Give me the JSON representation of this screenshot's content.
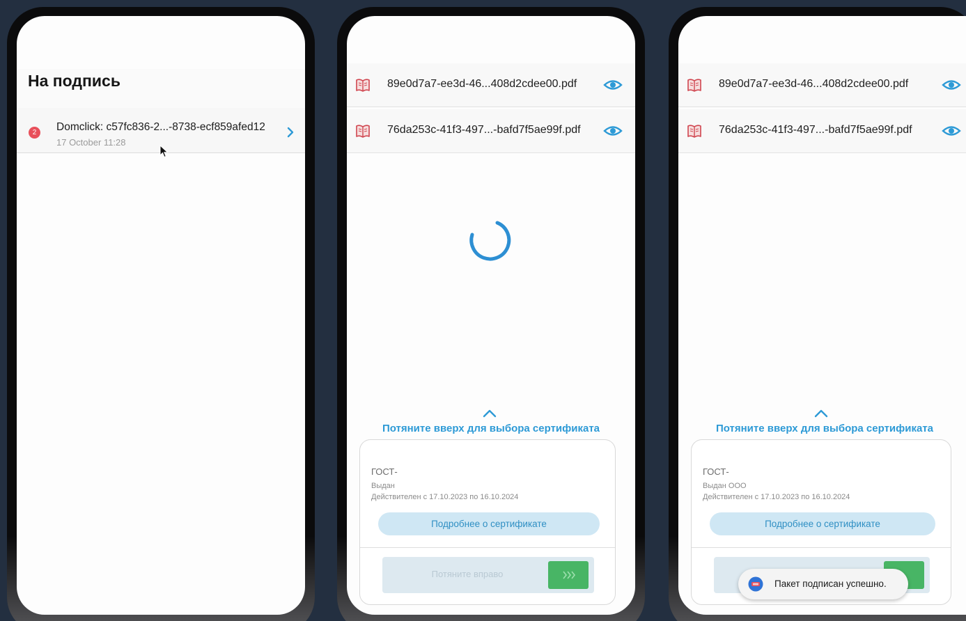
{
  "colors": {
    "accent": "#2d9ad6",
    "badge": "#e8505b",
    "swipe_knob": "#48b565",
    "background": "#232f40"
  },
  "screen1": {
    "title": "На подпись",
    "item": {
      "badge_count": "2",
      "title": "Domclick: c57fc836-2...-8738-ecf859afed12",
      "date": "17 October 11:28",
      "chevron_icon": "chevron-right-icon"
    }
  },
  "screen2": {
    "files": [
      {
        "name": "89e0d7a7-ee3d-46...408d2cdee00.pdf",
        "icon": "book-icon",
        "preview_icon": "eye-icon"
      },
      {
        "name": "76da253c-41f3-497...-bafd7f5ae99f.pdf",
        "icon": "book-icon",
        "preview_icon": "eye-icon"
      }
    ],
    "loading_icon": "spinner-icon",
    "pull_up_label": "Потяните вверх для выбора сертификата",
    "cert": {
      "name": "ГОСТ-",
      "issuer": "Выдан",
      "validity": "Действителен с 17.10.2023 по 16.10.2024",
      "details_button": "Подробнее о сертификате",
      "swipe_label": "Потяните вправо"
    }
  },
  "screen3": {
    "files": [
      {
        "name": "89e0d7a7-ee3d-46...408d2cdee00.pdf",
        "icon": "book-icon",
        "preview_icon": "eye-icon"
      },
      {
        "name": "76da253c-41f3-497...-bafd7f5ae99f.pdf",
        "icon": "book-icon",
        "preview_icon": "eye-icon"
      }
    ],
    "pull_up_label": "Потяните вверх для выбора сертификата",
    "cert": {
      "name": "ГОСТ-",
      "issuer": "Выдан ООО",
      "validity": "Действителен с 17.10.2023 по 16.10.2024",
      "details_button": "Подробнее о сертификате"
    },
    "toast": "Пакет подписан успешно."
  }
}
